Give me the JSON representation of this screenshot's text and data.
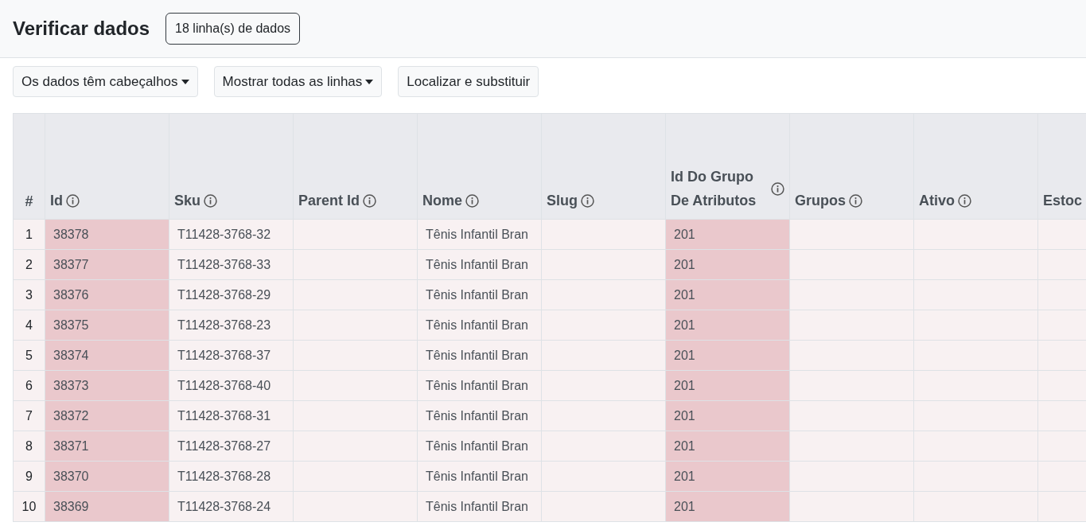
{
  "header": {
    "title": "Verificar dados",
    "row_count_badge": "18 linha(s) de dados"
  },
  "toolbar": [
    {
      "label": "Os dados têm cabeçalhos",
      "kind": "dropdown"
    },
    {
      "label": "Mostrar todas as linhas",
      "kind": "dropdown"
    },
    {
      "label": "Localizar e substituir",
      "kind": "button"
    }
  ],
  "table": {
    "number_heading": "#",
    "columns": [
      {
        "label": "Id",
        "highlighted": true,
        "info": true
      },
      {
        "label": "Sku",
        "highlighted": false,
        "info": true
      },
      {
        "label": "Parent Id",
        "highlighted": false,
        "info": true
      },
      {
        "label": "Nome",
        "highlighted": false,
        "info": true
      },
      {
        "label": "Slug",
        "highlighted": false,
        "info": true
      },
      {
        "label": "Id Do Grupo De Atributos",
        "highlighted": true,
        "info": true
      },
      {
        "label": "Grupos",
        "highlighted": false,
        "info": true
      },
      {
        "label": "Ativo",
        "highlighted": false,
        "info": true
      },
      {
        "label": "Estoc",
        "highlighted": false,
        "info": false
      }
    ],
    "rows": [
      {
        "number": "1",
        "cells": [
          "38378",
          "T11428-3768-32",
          null,
          "Tênis Infantil Bran",
          null,
          "201",
          null,
          null,
          null
        ]
      },
      {
        "number": "2",
        "cells": [
          "38377",
          "T11428-3768-33",
          null,
          "Tênis Infantil Bran",
          null,
          "201",
          null,
          null,
          null
        ]
      },
      {
        "number": "3",
        "cells": [
          "38376",
          "T11428-3768-29",
          null,
          "Tênis Infantil Bran",
          null,
          "201",
          null,
          null,
          null
        ]
      },
      {
        "number": "4",
        "cells": [
          "38375",
          "T11428-3768-23",
          null,
          "Tênis Infantil Bran",
          null,
          "201",
          null,
          null,
          null
        ]
      },
      {
        "number": "5",
        "cells": [
          "38374",
          "T11428-3768-37",
          null,
          "Tênis Infantil Bran",
          null,
          "201",
          null,
          null,
          null
        ]
      },
      {
        "number": "6",
        "cells": [
          "38373",
          "T11428-3768-40",
          null,
          "Tênis Infantil Bran",
          null,
          "201",
          null,
          null,
          null
        ]
      },
      {
        "number": "7",
        "cells": [
          "38372",
          "T11428-3768-31",
          null,
          "Tênis Infantil Bran",
          null,
          "201",
          null,
          null,
          null
        ]
      },
      {
        "number": "8",
        "cells": [
          "38371",
          "T11428-3768-27",
          null,
          "Tênis Infantil Bran",
          null,
          "201",
          null,
          null,
          null
        ]
      },
      {
        "number": "9",
        "cells": [
          "38370",
          "T11428-3768-28",
          null,
          "Tênis Infantil Bran",
          null,
          "201",
          null,
          null,
          null
        ]
      },
      {
        "number": "10",
        "cells": [
          "38369",
          "T11428-3768-24",
          null,
          "Tênis Infantil Bran",
          null,
          "201",
          null,
          null,
          null
        ]
      }
    ]
  }
}
